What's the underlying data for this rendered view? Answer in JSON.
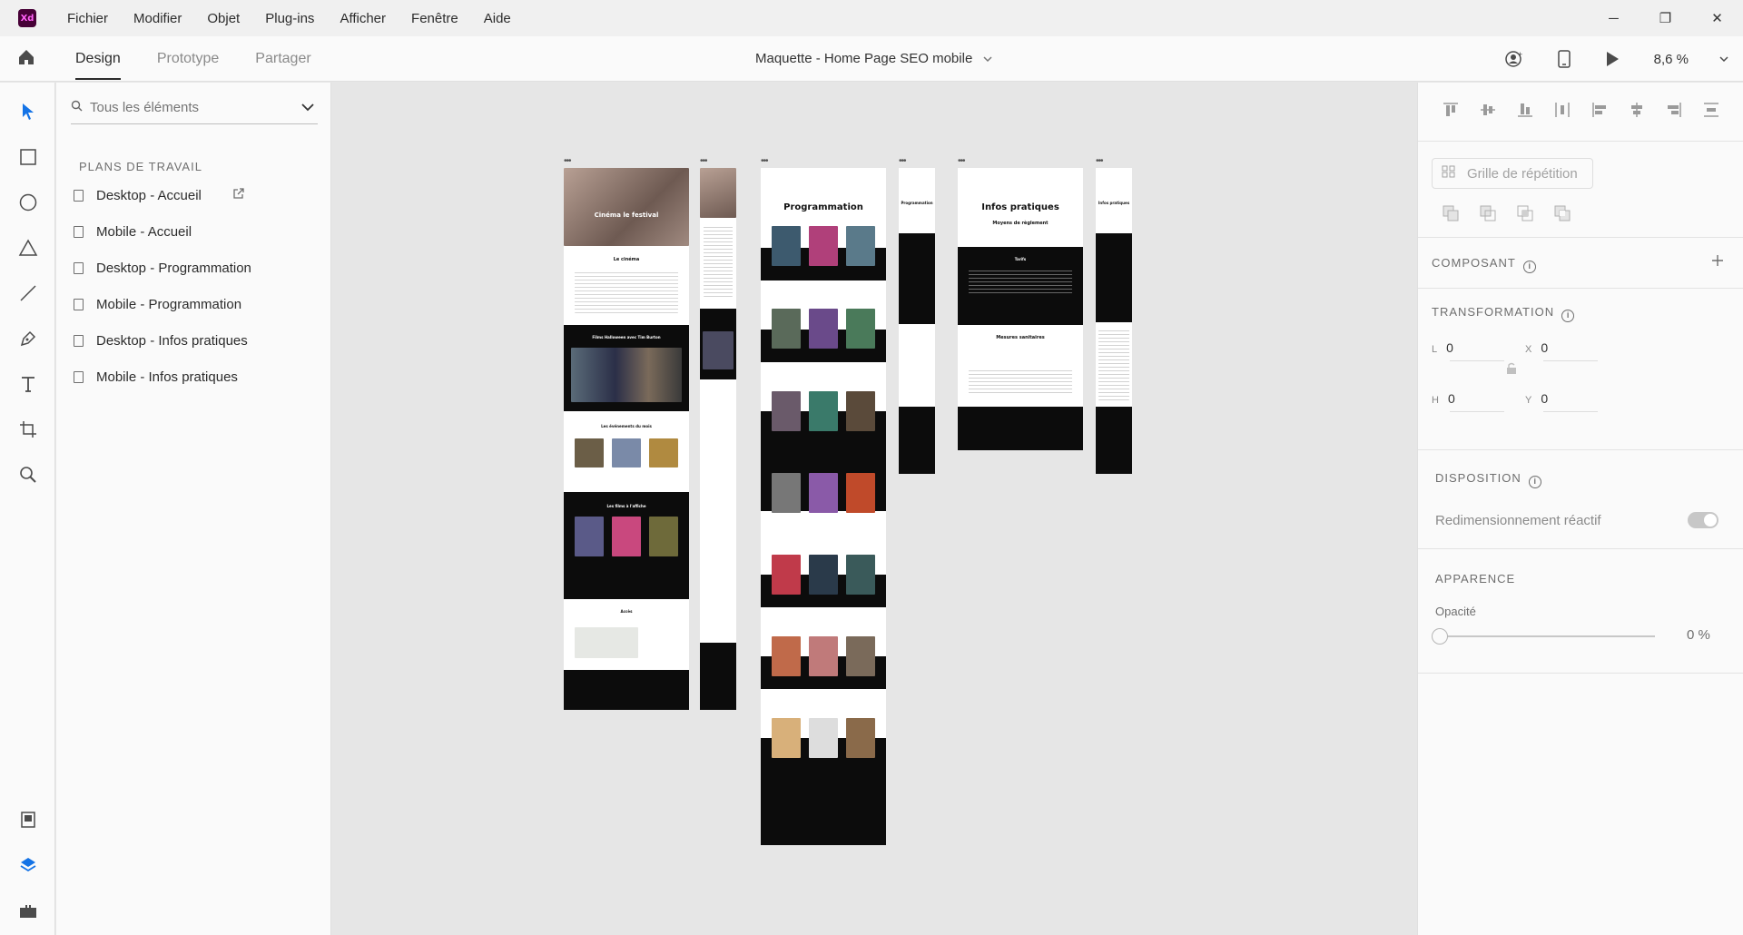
{
  "app": {
    "logo_text": "Xd"
  },
  "menu": [
    "Fichier",
    "Modifier",
    "Objet",
    "Plug-ins",
    "Afficher",
    "Fenêtre",
    "Aide"
  ],
  "window_controls": {
    "minimize": "─",
    "restore": "❐",
    "close": "✕"
  },
  "toolbar": {
    "modes": [
      "Design",
      "Prototype",
      "Partager"
    ],
    "active_mode": "Design",
    "document_title": "Maquette - Home Page SEO mobile",
    "zoom": "8,6 %"
  },
  "tools": [
    "select-tool",
    "rectangle-tool",
    "ellipse-tool",
    "polygon-tool",
    "line-tool",
    "pen-tool",
    "text-tool",
    "artboard-tool",
    "zoom-tool",
    "assets-panel",
    "layers-panel",
    "plugins-panel"
  ],
  "layers": {
    "search_placeholder": "Tous les éléments",
    "section_title": "PLANS DE TRAVAIL",
    "artboards": [
      "Desktop - Accueil",
      "Mobile - Accueil",
      "Desktop - Programmation",
      "Mobile - Programmation",
      "Desktop - Infos pratiques",
      "Mobile - Infos pratiques"
    ]
  },
  "canvas": {
    "artboards": [
      {
        "name": "Desktop - Accueil",
        "headings": [
          "Cinéma le festival",
          "Le cinéma",
          "Films Halloween avec Tim Burton",
          "Les événements du mois",
          "Les films à l'affiche",
          "Accès"
        ]
      },
      {
        "name": "Mobile - Accueil",
        "headings": []
      },
      {
        "name": "Desktop - Programmation",
        "headings": [
          "Programmation"
        ]
      },
      {
        "name": "Mobile - Programmation",
        "headings": [
          "Programmation"
        ]
      },
      {
        "name": "Desktop - Infos pratiques",
        "headings": [
          "Infos pratiques",
          "Moyens de règlement",
          "Tarifs",
          "Mesures sanitaires"
        ]
      },
      {
        "name": "Mobile - Infos pratiques",
        "headings": [
          "Infos pratiques"
        ]
      }
    ]
  },
  "properties": {
    "repeat_grid": "Grille de répétition",
    "component_label": "COMPOSANT",
    "transformation_label": "TRANSFORMATION",
    "w_label": "L",
    "w_value": "0",
    "h_label": "H",
    "h_value": "0",
    "x_label": "X",
    "x_value": "0",
    "y_label": "Y",
    "y_value": "0",
    "layout_label": "DISPOSITION",
    "responsive_resize": "Redimensionnement réactif",
    "appearance_label": "APPARENCE",
    "opacity_label": "Opacité",
    "opacity_value": "0 %"
  }
}
